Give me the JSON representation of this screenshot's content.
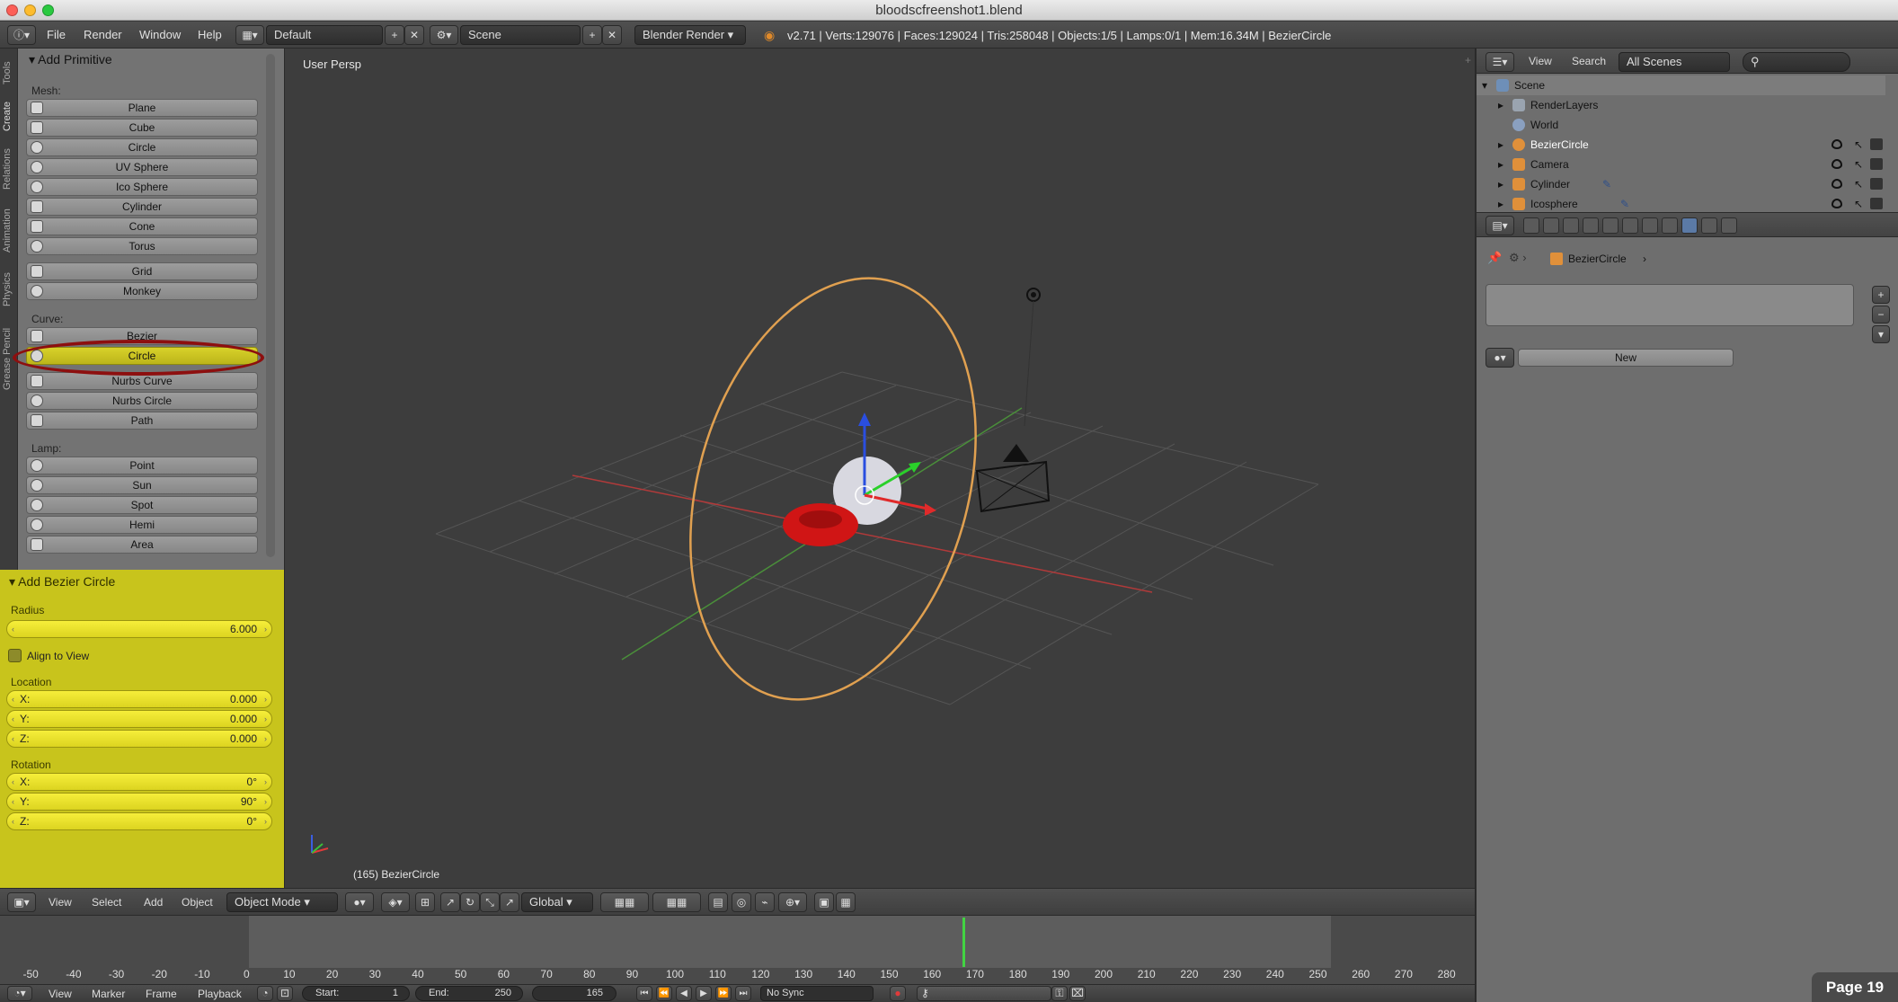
{
  "window": {
    "title": "bloodscfreenshot1.blend"
  },
  "menubar": {
    "items": [
      "File",
      "Render",
      "Window",
      "Help"
    ],
    "layout": "Default",
    "scene": "Scene",
    "engine": "Blender Render",
    "stats": "v2.71 | Verts:129076 | Faces:129024 | Tris:258048 | Objects:1/5 | Lamps:0/1 | Mem:16.34M | BezierCircle"
  },
  "tool_tabs": [
    "Tools",
    "Create",
    "Relations",
    "Animation",
    "Physics",
    "Grease Pencil"
  ],
  "add_primitive": {
    "title": "Add Primitive",
    "mesh_label": "Mesh:",
    "mesh": [
      "Plane",
      "Cube",
      "Circle",
      "UV Sphere",
      "Ico Sphere",
      "Cylinder",
      "Cone",
      "Torus",
      "Grid",
      "Monkey"
    ],
    "curve_label": "Curve:",
    "curve": [
      "Bezier",
      "Circle",
      "Nurbs Curve",
      "Nurbs Circle",
      "Path"
    ],
    "lamp_label": "Lamp:",
    "lamp": [
      "Point",
      "Sun",
      "Spot",
      "Hemi",
      "Area"
    ]
  },
  "operator": {
    "title": "Add Bezier Circle",
    "radius_label": "Radius",
    "radius": "6.000",
    "align_label": "Align to View",
    "location_label": "Location",
    "loc": {
      "x": "0.000",
      "y": "0.000",
      "z": "0.000"
    },
    "rotation_label": "Rotation",
    "rot": {
      "x": "0°",
      "y": "90°",
      "z": "0°"
    },
    "axis": {
      "x": "X:",
      "y": "Y:",
      "z": "Z:"
    }
  },
  "viewport": {
    "view_name": "User Persp",
    "object_info": "(165) BezierCircle"
  },
  "outliner": {
    "view": "View",
    "search": "Search",
    "filter": "All Scenes",
    "scene": "Scene",
    "render_layers": "RenderLayers",
    "world": "World",
    "objects": [
      "BezierCircle",
      "Camera",
      "Cylinder",
      "Icosphere"
    ]
  },
  "properties": {
    "object": "BezierCircle",
    "new_button": "New"
  },
  "view3d_header": {
    "menus": [
      "View",
      "Select",
      "Add",
      "Object"
    ],
    "mode": "Object Mode",
    "orientation": "Global"
  },
  "timeline": {
    "numbers": [
      "-50",
      "-40",
      "-30",
      "-20",
      "-10",
      "0",
      "10",
      "20",
      "30",
      "40",
      "50",
      "60",
      "70",
      "80",
      "90",
      "100",
      "110",
      "120",
      "130",
      "140",
      "150",
      "160",
      "170",
      "180",
      "190",
      "200",
      "210",
      "220",
      "230",
      "240",
      "250",
      "260",
      "270",
      "280"
    ]
  },
  "bottombar": {
    "menus": [
      "View",
      "Marker",
      "Frame",
      "Playback"
    ],
    "start_label": "Start:",
    "start": "1",
    "end_label": "End:",
    "end": "250",
    "current": "165",
    "sync": "No Sync"
  },
  "page_label": "Page 19"
}
